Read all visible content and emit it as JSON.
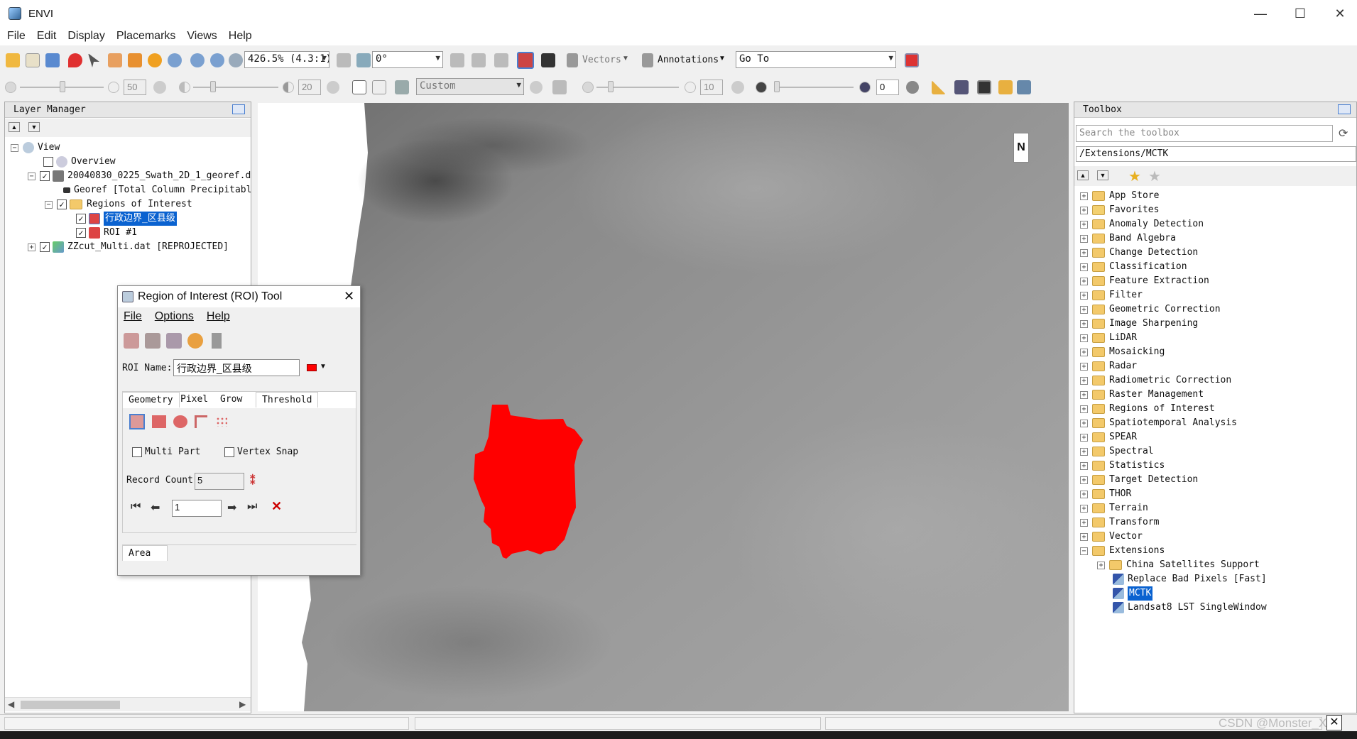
{
  "window": {
    "title": "ENVI"
  },
  "menu": [
    "File",
    "Edit",
    "Display",
    "Placemarks",
    "Views",
    "Help"
  ],
  "toolbar1": {
    "zoom_value": "426.5% (4.3:1)",
    "rotation_value": "0°",
    "vectors_label": "Vectors",
    "annotations_label": "Annotations",
    "goto_value": "Go To"
  },
  "toolbar2": {
    "brightness_value": "50",
    "contrast_value": "20",
    "stretch_value": "Custom",
    "sharpen_value": "10",
    "transparency_value": "0"
  },
  "layer_manager": {
    "title": "Layer Manager",
    "items": [
      {
        "label": "View",
        "checked": false
      },
      {
        "label": "Overview",
        "checked": false
      },
      {
        "label": "20040830_0225_Swath_2D_1_georef.d",
        "checked": true
      },
      {
        "label": "Georef [Total Column Precipitabl",
        "checked": false
      },
      {
        "label": "Regions of Interest",
        "checked": true
      },
      {
        "label": "行政边界_区县级",
        "checked": true
      },
      {
        "label": "ROI #1",
        "checked": true
      },
      {
        "label": "ZZcut_Multi.dat [REPROJECTED]",
        "checked": true
      }
    ]
  },
  "roi_tool": {
    "title": "Region of Interest (ROI) Tool",
    "menu": [
      "File",
      "Options",
      "Help"
    ],
    "roi_name_label": "ROI Name:",
    "roi_name_value": "行政边界_区县级",
    "roi_color": "#ff0000",
    "tabs": [
      "Geometry",
      "Pixel",
      "Grow",
      "Threshold"
    ],
    "multi_part_label": "Multi Part",
    "vertex_snap_label": "Vertex Snap",
    "record_count_label": "Record Count",
    "record_count_value": "5",
    "record_index_value": "1",
    "bottom_tab": "Area"
  },
  "toolbox": {
    "title": "Toolbox",
    "search_placeholder": "Search the toolbox",
    "path": "/Extensions/MCTK",
    "items": [
      "App Store",
      "Favorites",
      "Anomaly Detection",
      "Band Algebra",
      "Change Detection",
      "Classification",
      "Feature Extraction",
      "Filter",
      "Geometric Correction",
      "Image Sharpening",
      "LiDAR",
      "Mosaicking",
      "Radar",
      "Radiometric Correction",
      "Raster Management",
      "Regions of Interest",
      "Spatiotemporal Analysis",
      "SPEAR",
      "Spectral",
      "Statistics",
      "Target Detection",
      "THOR",
      "Terrain",
      "Transform",
      "Vector",
      "Extensions"
    ],
    "extension_items": [
      "China Satellites Support",
      "Replace Bad Pixels [Fast]",
      "MCTK",
      "Landsat8 LST SingleWindow"
    ]
  },
  "watermark": "CSDN @Monster_Xu",
  "colors": {
    "roi_fill": "#ff0000",
    "selection": "#0a62d0"
  }
}
